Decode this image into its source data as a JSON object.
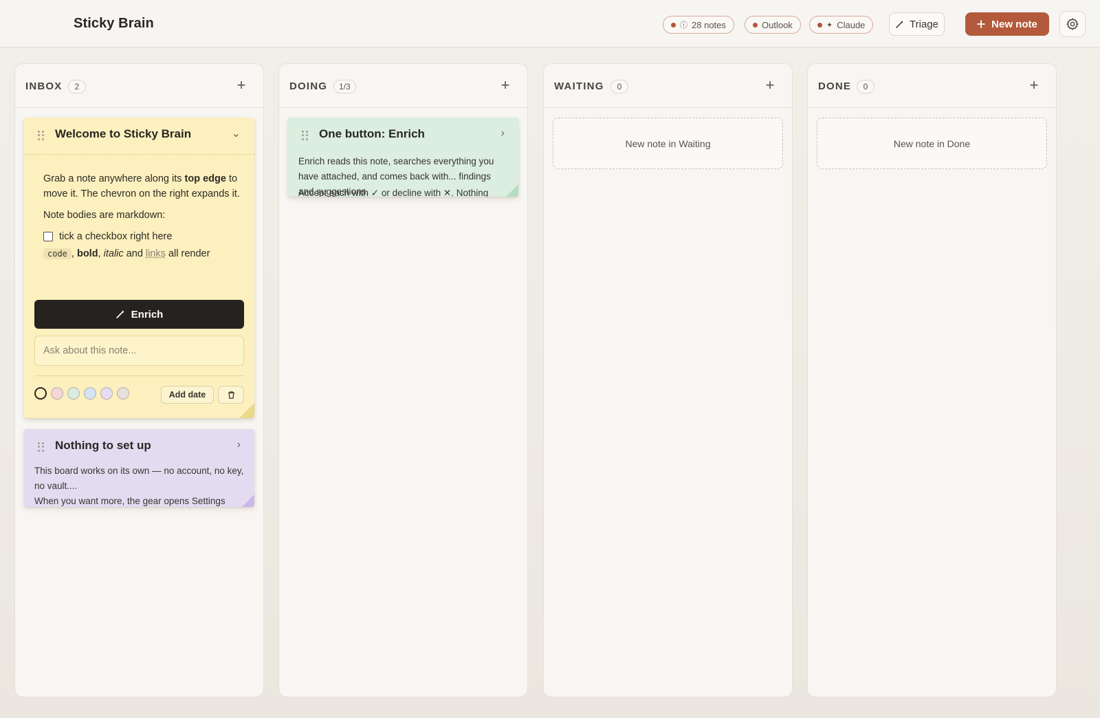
{
  "app": {
    "title": "Sticky Brain"
  },
  "header": {
    "status_pills": [
      {
        "label": "28 notes",
        "icon": "info-circle-icon"
      },
      {
        "label": "Outlook"
      },
      {
        "label": "Claude",
        "icon": "sparkle-icon"
      }
    ],
    "triage_label": "Triage",
    "new_note_label": "New note"
  },
  "colors": {
    "accent": "#b25a3b",
    "note_yellow": "#fbf0be",
    "note_green": "#dbeedf",
    "note_purple": "#e3dbf0"
  },
  "columns": [
    {
      "title": "INBOX",
      "count": "2"
    },
    {
      "title": "DOING",
      "count": "1/3"
    },
    {
      "title": "WAITING",
      "count": "0",
      "empty_label": "New note in Waiting"
    },
    {
      "title": "DONE",
      "count": "0",
      "empty_label": "New note in Done"
    }
  ],
  "notes": {
    "welcome": {
      "title": "Welcome to Sticky Brain",
      "line1_a": "Grab a note anywhere along its ",
      "line1_bold": "top edge",
      "line1_b": " to move it. The chevron on the right expands it.",
      "line2": "Note bodies are markdown:",
      "checkbox_label": "tick a checkbox right here",
      "md_code": "code",
      "md_comma1": ", ",
      "md_bold": "bold",
      "md_comma2": ", ",
      "md_italic": "italic",
      "md_and": " and ",
      "md_link": "links",
      "md_end": " all render",
      "enrich_label": "Enrich",
      "ask_placeholder": "Ask about this note...",
      "add_date_label": "Add date",
      "swatch_colors": [
        "#fbf0be",
        "#f6d6d8",
        "#d9ecdf",
        "#d5e4f5",
        "#e6dcf3",
        "#e6e1da"
      ]
    },
    "enrich": {
      "title": "One button: Enrich",
      "text1": "Enrich reads this note, searches everything you have attached, and comes back with... findings and suggestions.",
      "text2": "Accept each with ✓ or decline with ✕. Nothing"
    },
    "setup": {
      "title": "Nothing to set up",
      "text1": "This board works on its own — no account, no key, no vault....",
      "text2": "When you want more, the gear opens Settings"
    }
  }
}
